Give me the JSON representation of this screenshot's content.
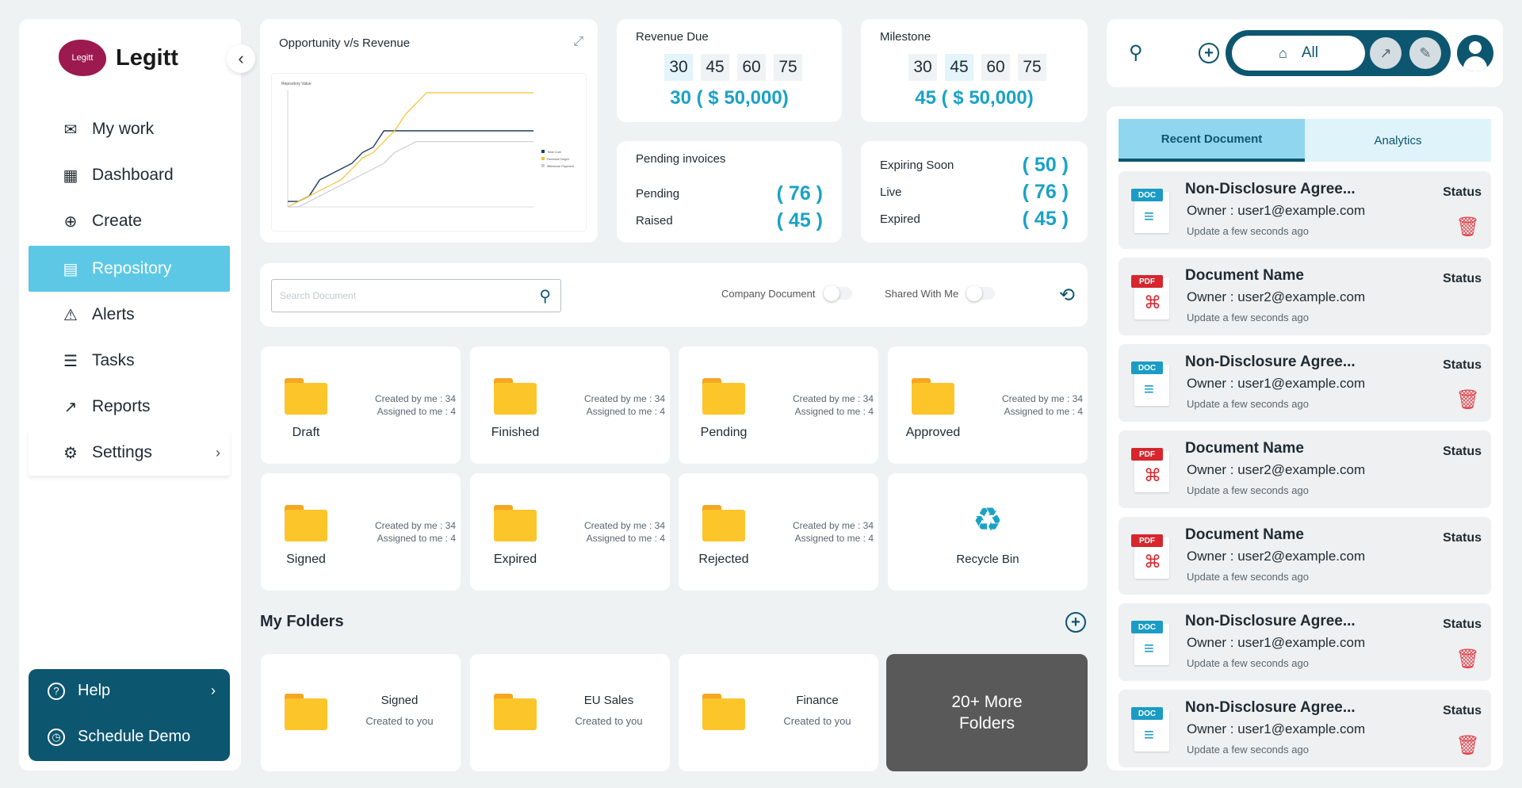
{
  "brand": {
    "logo_text": "Legitt",
    "logo_mark_text": "Legitt"
  },
  "sidebar": {
    "items": [
      {
        "label": "My work",
        "icon": "mail-icon"
      },
      {
        "label": "Dashboard",
        "icon": "grid-icon"
      },
      {
        "label": "Create",
        "icon": "plus-circle-icon"
      },
      {
        "label": "Repository",
        "icon": "repository-icon",
        "active": true
      },
      {
        "label": "Alerts",
        "icon": "warning-icon"
      },
      {
        "label": "Tasks",
        "icon": "checklist-icon"
      },
      {
        "label": "Reports",
        "icon": "trend-icon"
      },
      {
        "label": "Settings",
        "icon": "gear-icon"
      }
    ],
    "help": "Help",
    "schedule_demo": "Schedule Demo"
  },
  "chart_card": {
    "title": "Opportunity v/s Revenue",
    "inner_title": "Repository Value"
  },
  "chart_data": {
    "type": "line",
    "title": "Repository Value",
    "x": [
      0,
      1,
      2,
      3,
      4,
      5,
      6,
      7,
      8,
      9,
      10,
      11,
      12,
      13,
      14,
      15,
      16,
      17,
      18,
      19,
      20,
      21,
      22,
      23
    ],
    "series": [
      {
        "name": "Total Cost",
        "values": [
          1,
          1,
          2,
          5,
          6,
          7,
          8,
          10,
          11,
          14,
          14,
          14,
          14,
          14,
          14,
          14,
          14,
          14,
          14,
          14,
          14,
          14,
          14,
          14
        ]
      },
      {
        "name": "Renewal Target",
        "values": [
          0,
          1,
          2,
          3,
          4,
          5,
          7,
          9,
          10,
          12,
          14,
          17,
          19,
          21,
          21,
          21,
          21,
          21,
          21,
          21,
          21,
          21,
          21,
          21
        ]
      },
      {
        "name": "Milestone Payment",
        "values": [
          0,
          0,
          1,
          2,
          3,
          4,
          5,
          6,
          7,
          8,
          10,
          11,
          12,
          12,
          12,
          12,
          12,
          12,
          12,
          12,
          12,
          12,
          12,
          12
        ]
      }
    ],
    "colors": [
      "#1f3b5a",
      "#f7c22b",
      "#c9ced3"
    ],
    "grid": false
  },
  "revenue_due": {
    "title": "Revenue Due",
    "digits": [
      "30",
      "45",
      "60",
      "75"
    ],
    "highlight": 0,
    "value": "30 ( $ 50,000)"
  },
  "milestone": {
    "title": "Milestone",
    "digits": [
      "30",
      "45",
      "60",
      "75"
    ],
    "highlight": 1,
    "value": "45 ( $ 50,000)"
  },
  "pending_invoices": {
    "title": "Pending invoices",
    "rows": [
      {
        "k": "Pending",
        "v": "( 76 )"
      },
      {
        "k": "Raised",
        "v": "( 45 )"
      }
    ]
  },
  "expiring": {
    "rows": [
      {
        "k": "Expiring Soon",
        "v": "( 50 )"
      },
      {
        "k": "Live",
        "v": "( 76 )"
      },
      {
        "k": "Expired",
        "v": "( 45 )"
      }
    ]
  },
  "search": {
    "placeholder": "Search Document",
    "company_doc": "Company Document",
    "shared": "Shared With Me"
  },
  "folders": [
    {
      "name": "Draft",
      "created": "Created by me : 34",
      "assigned": "Assigned to me : 4"
    },
    {
      "name": "Finished",
      "created": "Created by me : 34",
      "assigned": "Assigned to me : 4"
    },
    {
      "name": "Pending",
      "created": "Created by me : 34",
      "assigned": "Assigned to me : 4"
    },
    {
      "name": "Approved",
      "created": "Created by me : 34",
      "assigned": "Assigned to me : 4"
    },
    {
      "name": "Signed",
      "created": "Created by me : 34",
      "assigned": "Assigned to me : 4"
    },
    {
      "name": "Expired",
      "created": "Created by me : 34",
      "assigned": "Assigned to me : 4"
    },
    {
      "name": "Rejected",
      "created": "Created by me : 34",
      "assigned": "Assigned to me : 4"
    }
  ],
  "recycle_bin": "Recycle Bin",
  "my_folders": {
    "title": "My Folders",
    "items": [
      {
        "name": "Signed",
        "sub": "Created to you"
      },
      {
        "name": "EU Sales",
        "sub": "Created to you"
      },
      {
        "name": "Finance",
        "sub": "Created to you"
      }
    ],
    "more": "20+ More Folders"
  },
  "topbar": {
    "filter_all": "All"
  },
  "docs": {
    "tabs": [
      "Recent Document",
      "Analytics"
    ],
    "status_label": "Status",
    "rows": [
      {
        "type": "DOC",
        "title": "Non-Disclosure Agree...",
        "owner": "Owner : user1@example.com",
        "time": "Update a few seconds ago",
        "deletable": true
      },
      {
        "type": "PDF",
        "title": "Document Name",
        "owner": "Owner : user2@example.com",
        "time": "Update a few seconds ago",
        "deletable": false
      },
      {
        "type": "DOC",
        "title": "Non-Disclosure Agree...",
        "owner": "Owner : user1@example.com",
        "time": "Update a few seconds ago",
        "deletable": true
      },
      {
        "type": "PDF",
        "title": "Document Name",
        "owner": "Owner : user2@example.com",
        "time": "Update a few seconds ago",
        "deletable": false
      },
      {
        "type": "PDF",
        "title": "Document Name",
        "owner": "Owner : user2@example.com",
        "time": "Update a few seconds ago",
        "deletable": false
      },
      {
        "type": "DOC",
        "title": "Non-Disclosure Agree...",
        "owner": "Owner : user1@example.com",
        "time": "Update a few seconds ago",
        "deletable": true
      },
      {
        "type": "DOC",
        "title": "Non-Disclosure Agree...",
        "owner": "Owner : user1@example.com",
        "time": "Update a few seconds ago",
        "deletable": true
      }
    ]
  },
  "colors": {
    "accent": "#1aa2c6",
    "dark": "#0d5670",
    "active_nav": "#5cc8e6",
    "folder": "#fcc52a",
    "delete": "#e2424a"
  }
}
